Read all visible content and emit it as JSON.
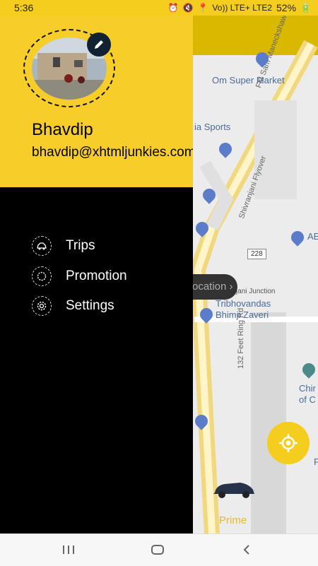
{
  "status": {
    "time": "5:36",
    "network": "Vo)) LTE+ LTE2",
    "battery": "52%"
  },
  "map": {
    "labels": [
      "Om Super Market",
      "ia Sports",
      "FM Sam Maneckshaw Flyover",
      "Shivranjani Flyover",
      "132 Feet Ring Rd",
      "228",
      "Shivranjani Junction",
      "Tribhovandas Bhimji Zaveri",
      "AE",
      "Chir",
      "of C",
      "P"
    ],
    "location_pill": "ocation",
    "car_label": "Prime"
  },
  "drawer": {
    "user_name": "Bhavdip",
    "user_email": "bhavdip@xhtmljunkies.com",
    "menu": [
      {
        "label": "Trips",
        "icon": "car-icon"
      },
      {
        "label": "Promotion",
        "icon": "badge-icon"
      },
      {
        "label": "Settings",
        "icon": "gear-icon"
      }
    ]
  },
  "colors": {
    "accent": "#f7cd2a",
    "drawer_bg": "#000000"
  }
}
